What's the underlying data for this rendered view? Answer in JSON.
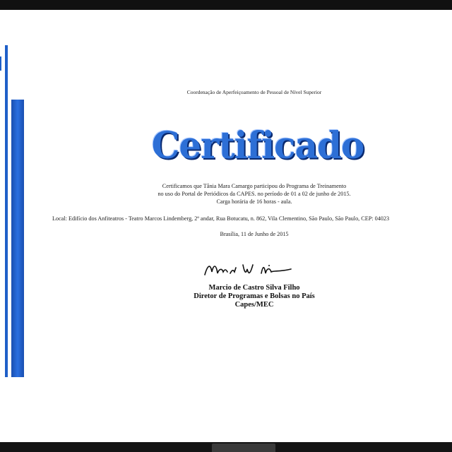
{
  "certificate": {
    "header": "Coordenação de Aperfeiçoamento de Pessoal de Nível Superior",
    "title": "Certificado",
    "body_line_1": "Certificamos que Tânia Mara Camargo participou do Programa de Treinamento",
    "body_line_2": "no uso do Portal de Periódicos da CAPES. no período de 01 a 02 de junho de 2015.",
    "body_line_3": "Carga horária de 16 horas - aula.",
    "local": "Local: Edifício dos Anfiteatros - Teatro Marcos Lindemberg, 2º andar, Rua Botucatu, n. 862, Vila Clementino, São Paulo, São Paulo, CEP: 04023",
    "date": "Brasília, 11 de Junho de 2015",
    "signer_name": "Marcio de Castro Silva Filho",
    "signer_role": "Diretor de Programas e Bolsas no País",
    "signer_org": "Capes/MEC"
  },
  "colors": {
    "accent": "#2d6fd6",
    "stripe": "#1f5fc8",
    "frame": "#111111"
  }
}
